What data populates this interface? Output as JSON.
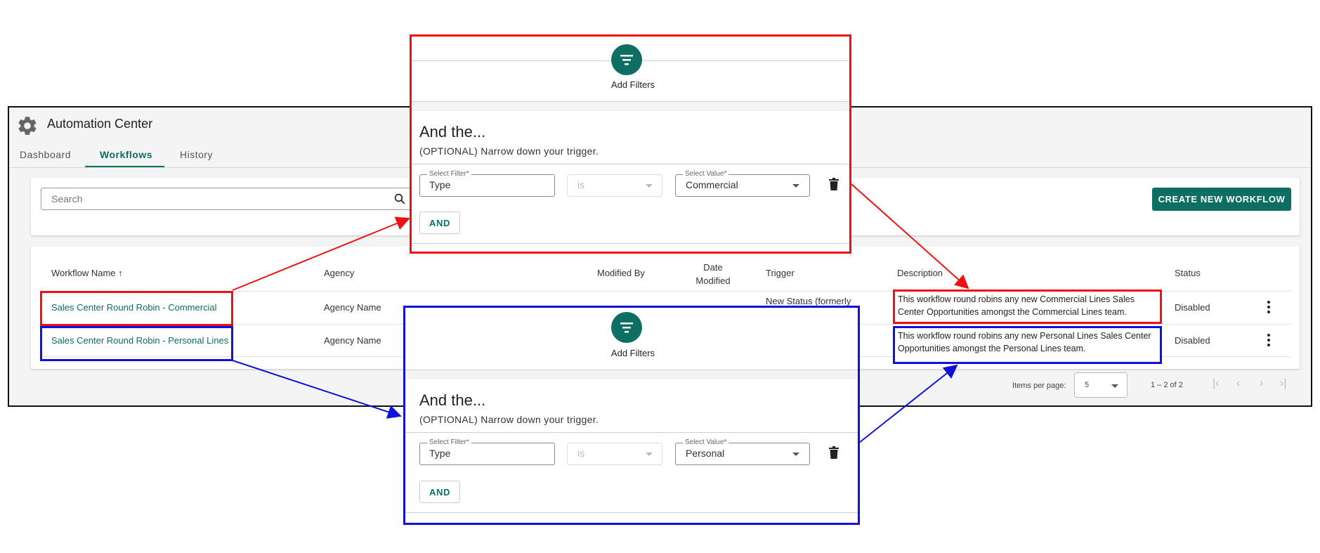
{
  "app": {
    "title": "Automation Center",
    "tabs": [
      {
        "label": "Dashboard"
      },
      {
        "label": "Workflows",
        "active": true
      },
      {
        "label": "History"
      }
    ],
    "search_placeholder": "Search",
    "create_button": "CREATE NEW WORKFLOW"
  },
  "table": {
    "headers": {
      "name": "Workflow Name",
      "sort_indicator": "↑",
      "agency": "Agency",
      "modified_by": "Modified By",
      "date_modified_1": "Date",
      "date_modified_2": "Modified",
      "trigger": "Trigger",
      "description": "Description",
      "status": "Status"
    },
    "rows": [
      {
        "name": "Sales Center Round Robin - Commercial",
        "agency": "Agency Name",
        "trigger": "New Status (formerly",
        "description": "This workflow round robins any new Commercial Lines Sales Center Opportunities amongst the Commercial Lines team.",
        "status": "Disabled"
      },
      {
        "name": "Sales Center Round Robin - Personal Lines",
        "agency": "Agency Name",
        "description": "This workflow round robins any new Personal Lines Sales Center Opportunities amongst the Personal Lines team.",
        "status": "Disabled"
      }
    ],
    "footer": {
      "items_per_page_label": "Items per page:",
      "items_per_page_value": "5",
      "range": "1 – 2 of 2"
    }
  },
  "panels": [
    {
      "add_filters": "Add Filters",
      "and_title": "And the...",
      "optional": "(OPTIONAL) Narrow down your trigger.",
      "filter_label": "Select Filter*",
      "filter_value": "Type",
      "operator": "is",
      "value_label": "Select Value*",
      "value": "Commercial",
      "and_button": "AND"
    },
    {
      "add_filters": "Add Filters",
      "and_title": "And the...",
      "optional": "(OPTIONAL) Narrow down your trigger.",
      "filter_label": "Select Filter*",
      "filter_value": "Type",
      "operator": "is",
      "value_label": "Select Value*",
      "value": "Personal",
      "and_button": "AND"
    }
  ],
  "colors": {
    "accent": "#0d6e63",
    "highlight_commercial": "#ee1111",
    "highlight_personal": "#1111dd"
  },
  "icons": [
    "gear-icon",
    "search-icon",
    "filter-icon",
    "trash-icon",
    "kebab-icon",
    "chevron-down-icon",
    "first-page-icon",
    "prev-page-icon",
    "next-page-icon",
    "last-page-icon"
  ]
}
